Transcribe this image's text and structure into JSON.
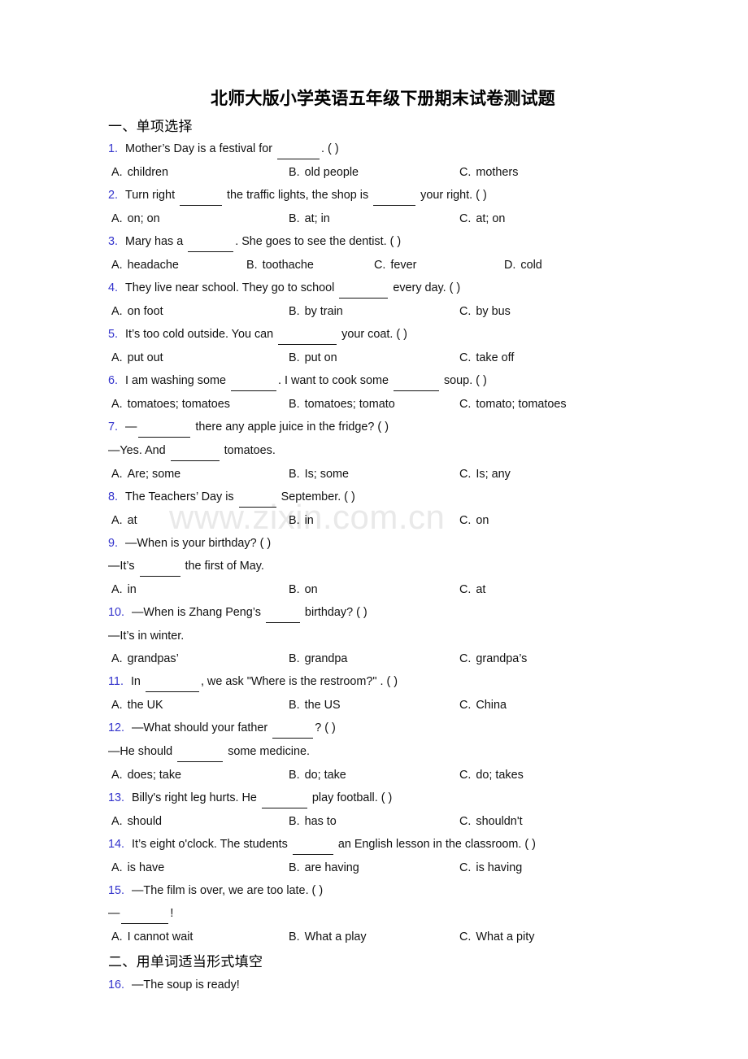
{
  "document": {
    "title": "北师大版小学英语五年级下册期末试卷测试题",
    "watermark": "www.zixin.com.cn",
    "number_color": "#3333cc"
  },
  "sections": [
    {
      "heading": "一、单项选择"
    },
    {
      "heading": "二、用单词适当形式填空"
    }
  ],
  "questions": [
    {
      "num": "1.",
      "text_before": "Mother’s Day is a festival for ",
      "blank1": 52,
      "text_after": ". (   )",
      "options": [
        {
          "label": "A.",
          "text": "children"
        },
        {
          "label": "B.",
          "text": "old people"
        },
        {
          "label": "C.",
          "text": "mothers"
        }
      ]
    },
    {
      "num": "2.",
      "text_before": "Turn right ",
      "blank1": 52,
      "text_mid": " the traffic lights, the shop is ",
      "blank2": 52,
      "text_after": " your right. (   )",
      "options": [
        {
          "label": "A.",
          "text": "on; on"
        },
        {
          "label": "B.",
          "text": "at; in"
        },
        {
          "label": "C.",
          "text": "at; on"
        }
      ]
    },
    {
      "num": "3.",
      "text_before": "Mary has a ",
      "blank1": 56,
      "text_after": ". She goes to see the dentist. (  )",
      "options": [
        {
          "label": "A.",
          "text": "headache"
        },
        {
          "label": "B.",
          "text": "toothache"
        },
        {
          "label": "C.",
          "text": "fever"
        },
        {
          "label": "D.",
          "text": "cold"
        }
      ]
    },
    {
      "num": "4.",
      "text_before": "They live near school. They go to school ",
      "blank1": 60,
      "text_after": " every day. (  )",
      "options": [
        {
          "label": "A.",
          "text": "on foot"
        },
        {
          "label": "B.",
          "text": "by train"
        },
        {
          "label": "C.",
          "text": "by bus"
        }
      ]
    },
    {
      "num": "5.",
      "text_before": "It’s too cold outside. You can ",
      "blank1": 72,
      "text_after": " your coat. (   )",
      "options": [
        {
          "label": "A.",
          "text": "put out"
        },
        {
          "label": "B.",
          "text": "put on"
        },
        {
          "label": "C.",
          "text": "take off"
        }
      ]
    },
    {
      "num": "6.",
      "text_before": "I am washing some ",
      "blank1": 56,
      "text_mid": ". I want to cook some ",
      "blank2": 56,
      "text_after": " soup. (   )",
      "options": [
        {
          "label": "A.",
          "text": "tomatoes; tomatoes"
        },
        {
          "label": "B.",
          "text": "tomatoes; tomato"
        },
        {
          "label": "C.",
          "text": "tomato; tomatoes"
        }
      ]
    },
    {
      "num": "7.",
      "text_before": "—",
      "blank1": 64,
      "text_after": " there any apple juice in the fridge? (   )",
      "continuation": {
        "before": "—Yes. And ",
        "blank": 60,
        "after": " tomatoes."
      },
      "options": [
        {
          "label": "A.",
          "text": "Are; some"
        },
        {
          "label": "B.",
          "text": "Is; some"
        },
        {
          "label": "C.",
          "text": "Is; any"
        }
      ]
    },
    {
      "num": "8.",
      "text_before": "The Teachers’ Day is ",
      "blank1": 46,
      "text_after": " September. (  )",
      "options": [
        {
          "label": "A.",
          "text": "at"
        },
        {
          "label": "B.",
          "text": "in"
        },
        {
          "label": "C.",
          "text": "on"
        }
      ]
    },
    {
      "num": "9.",
      "text_before": "—When is your birthday? (   )",
      "continuation": {
        "before": "—It’s ",
        "blank": 50,
        "after": " the first of May."
      },
      "options": [
        {
          "label": "A.",
          "text": "in"
        },
        {
          "label": "B.",
          "text": "on"
        },
        {
          "label": "C.",
          "text": "at"
        }
      ]
    },
    {
      "num": "10.",
      "text_before": "—When is Zhang Peng’s ",
      "blank1": 42,
      "text_after": " birthday? (   )",
      "continuation": {
        "before": "—It’s in winter.",
        "blank": 0,
        "after": ""
      },
      "options": [
        {
          "label": "A.",
          "text": "grandpas’"
        },
        {
          "label": "B.",
          "text": "grandpa"
        },
        {
          "label": "C.",
          "text": "grandpa’s"
        }
      ]
    },
    {
      "num": "11.",
      "text_before": "In ",
      "blank1": 66,
      "text_after": ", we ask \"Where is the restroom?\" . (   )",
      "options": [
        {
          "label": "A.",
          "text": "the UK"
        },
        {
          "label": "B.",
          "text": "the US"
        },
        {
          "label": "C.",
          "text": "China"
        }
      ]
    },
    {
      "num": "12.",
      "text_before": "—What should your father ",
      "blank1": 50,
      "text_after": "? (   )",
      "continuation": {
        "before": "—He should ",
        "blank": 56,
        "after": " some medicine."
      },
      "options": [
        {
          "label": "A.",
          "text": "does; take"
        },
        {
          "label": "B.",
          "text": "do; take"
        },
        {
          "label": "C.",
          "text": "do; takes"
        }
      ]
    },
    {
      "num": "13.",
      "text_before": "Billy's right leg hurts. He ",
      "blank1": 56,
      "text_after": " play football. (  )",
      "options": [
        {
          "label": "A.",
          "text": "should"
        },
        {
          "label": "B.",
          "text": "has to"
        },
        {
          "label": "C.",
          "text": "shouldn't"
        }
      ]
    },
    {
      "num": "14.",
      "text_before": "It’s eight o'clock. The students ",
      "blank1": 50,
      "text_after": " an English lesson in the classroom. (    )",
      "options": [
        {
          "label": "A.",
          "text": "is have"
        },
        {
          "label": "B.",
          "text": "are having"
        },
        {
          "label": "C.",
          "text": "is having"
        }
      ]
    },
    {
      "num": "15.",
      "text_before": "—The film is over, we are too late. (   )",
      "continuation": {
        "before": "—",
        "blank": 58,
        "after": "!"
      },
      "options": [
        {
          "label": "A.",
          "text": "I cannot wait"
        },
        {
          "label": "B.",
          "text": "What a play"
        },
        {
          "label": "C.",
          "text": "What a pity"
        }
      ]
    },
    {
      "num": "16.",
      "text_before": "—The soup is ready!",
      "options": []
    }
  ]
}
